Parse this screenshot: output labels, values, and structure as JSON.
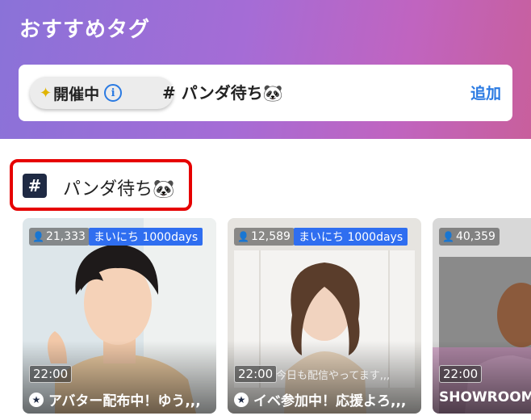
{
  "banner": {
    "title": "おすすめタグ",
    "event_label": "開催中",
    "tag_text": "# パンダ待ち🐼",
    "add_label": "追加"
  },
  "section": {
    "hash_label": "#",
    "title": "パンダ待ち🐼"
  },
  "cards": [
    {
      "viewers": "21,333",
      "daily_badge": "まいにち 1000days",
      "time": "22:00",
      "subtitle": "",
      "title": "アバター配布中！ゆう,,,"
    },
    {
      "viewers": "12,589",
      "daily_badge": "まいにち 1000days",
      "time": "22:00",
      "subtitle": "今日も配信やってます,,,",
      "title": "イベ参加中！応援よろ,,,"
    },
    {
      "viewers": "40,359",
      "daily_badge": "",
      "time": "22:00",
      "subtitle": "",
      "title": "SHOWROOM"
    }
  ],
  "colors": {
    "accent": "#2a7ae2",
    "daily_badge": "#2f6ef0",
    "highlight": "#e60000"
  }
}
